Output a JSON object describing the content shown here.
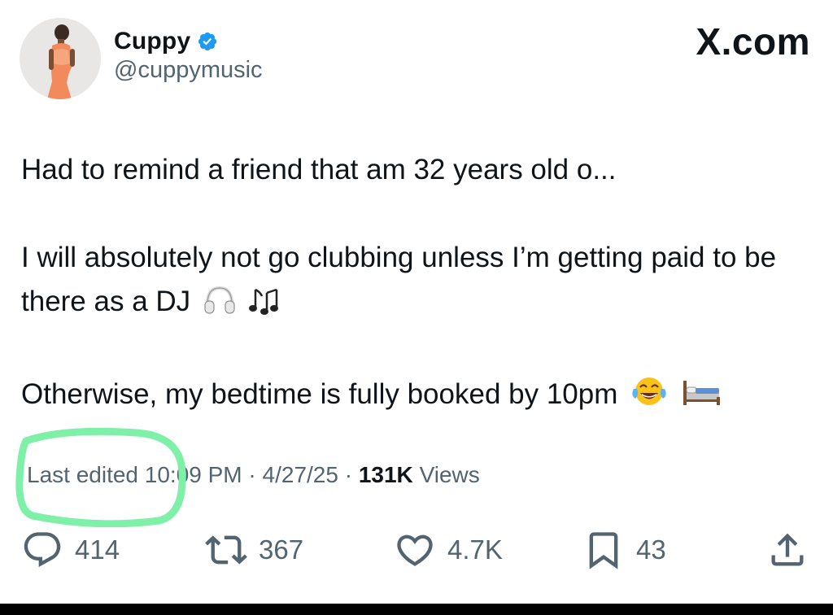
{
  "author": {
    "display_name": "Cuppy",
    "handle": "@cuppymusic",
    "verified": true
  },
  "brand": {
    "text": "X.com"
  },
  "tweet": {
    "paragraphs": [
      "Had to remind a friend that am 32 years old o...",
      "I will absolutely not go clubbing unless I’m getting paid to be there as a DJ",
      "Otherwise, my bedtime is fully booked by 10pm"
    ],
    "emojis": {
      "paragraph_2": [
        "headphones-emoji",
        "musical-notes-emoji"
      ],
      "paragraph_3": [
        "tears-of-joy-emoji",
        "bed-emoji"
      ]
    }
  },
  "meta": {
    "edited_label": "Last edited",
    "time": "10:09 PM",
    "separator": "·",
    "date": "4/27/25",
    "views_count": "131K",
    "views_label": "Views"
  },
  "actions": {
    "replies": "414",
    "reposts": "367",
    "likes": "4.7K",
    "bookmarks": "43"
  },
  "colors": {
    "text_primary": "#0f1419",
    "text_secondary": "#536471",
    "verified_blue": "#1d9bf0",
    "highlight_green": "#7ff0a8"
  }
}
